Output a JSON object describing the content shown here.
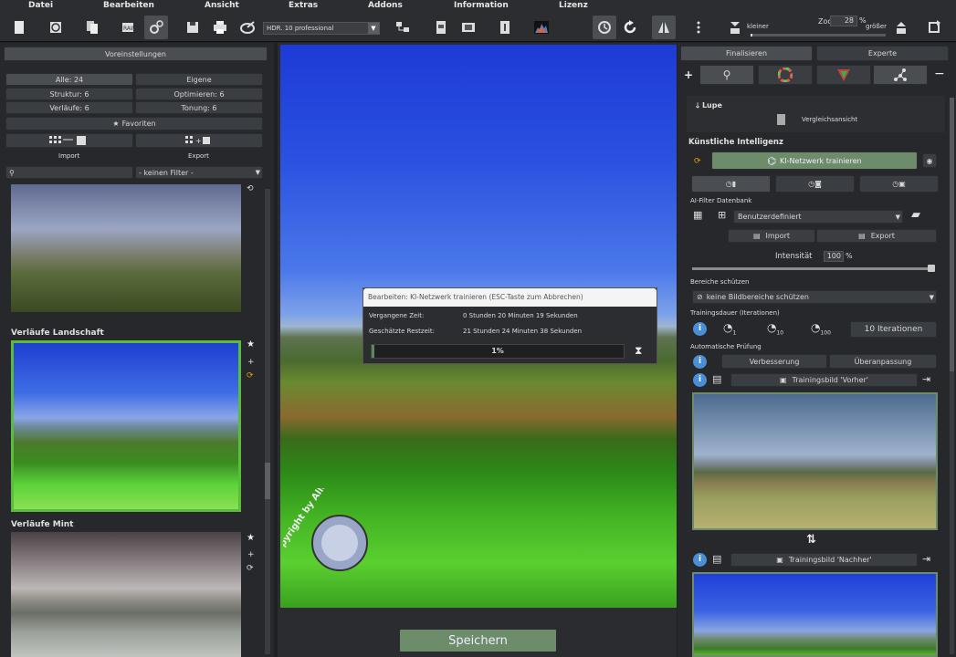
{
  "menu": [
    "Datei",
    "Bearbeiten",
    "Ansicht",
    "Extras",
    "Addons",
    "Information",
    "Lizenz"
  ],
  "toolbar": {
    "preset": "HDR. 10 professional",
    "zoom_label": "Zoo",
    "zoom_value": "28",
    "zoom_unit": "%",
    "smaller": "kleiner",
    "larger": "größer"
  },
  "left": {
    "presets_btn": "Voreinstellungen",
    "filters": [
      "Alle: 24",
      "Eigene",
      "Struktur: 6",
      "Optimieren: 6",
      "Verläufe: 6",
      "Tonung: 6"
    ],
    "favorites": "Favoriten",
    "import": "Import",
    "export": "Export",
    "filter_select": "- keinen Filter -",
    "groups": [
      "Verläufe Landschaft",
      "Verläufe Mint"
    ]
  },
  "dialog": {
    "title": "Bearbeiten: KI-Netzwerk trainieren (ESC-Taste zum Abbrechen)",
    "elapsed_label": "Vergangene Zeit:",
    "elapsed_value": "0 Stunden 20 Minuten 19 Sekunden",
    "remaining_label": "Geschätzte Restzeit:",
    "remaining_value": "21 Stunden 24 Minuten 38 Sekunden",
    "progress": "1%",
    "progress_fraction": 0.01
  },
  "watermark": "Copyright by Allesdesign.eu",
  "save": "Speichern",
  "right": {
    "tabs": [
      "Finalisieren",
      "Experte"
    ],
    "lupe": "Lupe",
    "compare": "Vergleichsansicht",
    "ai_header": "Künstliche Intelligenz",
    "train_btn": "KI-Netzwerk trainieren",
    "db_label": "AI-Filter Datenbank",
    "db_select": "Benutzerdefiniert",
    "import": "Import",
    "export": "Export",
    "intensity_label": "Intensität",
    "intensity_value": "100",
    "intensity_unit": "%",
    "protect_label": "Bereiche schützen",
    "protect_select": "keine Bildbereiche schützen",
    "duration_label": "Trainingsdauer (Iterationen)",
    "iter_subs": [
      "1",
      "10",
      "100"
    ],
    "iter_btn": "10 Iterationen",
    "auto_label": "Automatische Prüfung",
    "improve_btn": "Verbesserung",
    "fit_btn": "Überanpassung",
    "before_btn": "Trainingsbild 'Vorher'",
    "after_btn": "Trainingsbild 'Nachher'"
  }
}
